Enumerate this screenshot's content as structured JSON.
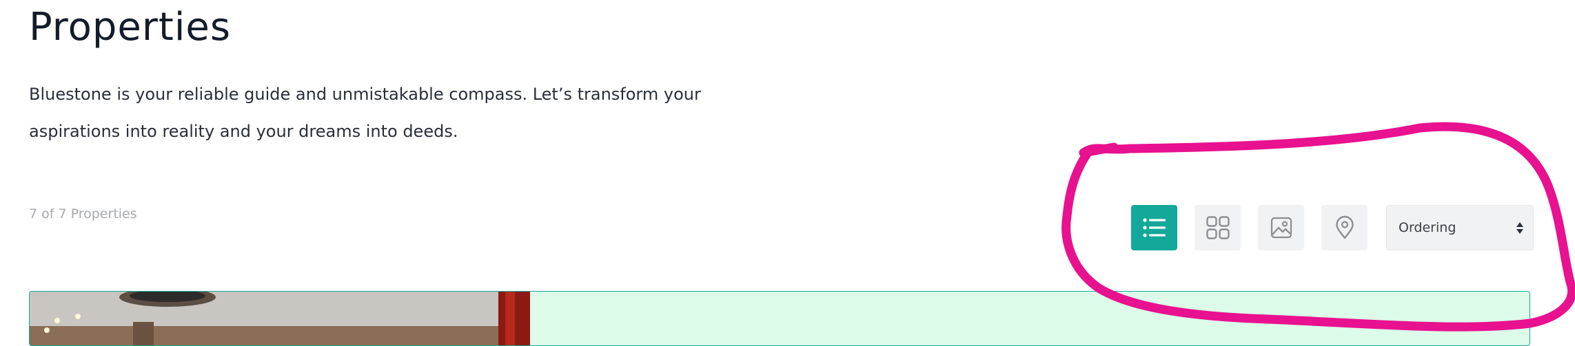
{
  "page": {
    "title": "Properties",
    "intro": "Bluestone is your reliable guide and unmistakable compass. Let’s transform your aspirations into reality and your dreams into deeds."
  },
  "results": {
    "count_text": "7 of 7 Properties"
  },
  "toolbar": {
    "views": [
      {
        "name": "list-view",
        "icon": "list-icon",
        "active": true
      },
      {
        "name": "grid-view",
        "icon": "grid-icon",
        "active": false
      },
      {
        "name": "gallery-view",
        "icon": "image-icon",
        "active": false
      },
      {
        "name": "map-view",
        "icon": "map-pin-icon",
        "active": false
      }
    ],
    "ordering": {
      "selected": "Ordering",
      "icon": "sort-arrows-icon"
    }
  },
  "colors": {
    "accent": "#13a89a",
    "button_bg": "#f1f2f3",
    "card_bg": "#dcfbe9",
    "annotation": "#e8118f"
  }
}
